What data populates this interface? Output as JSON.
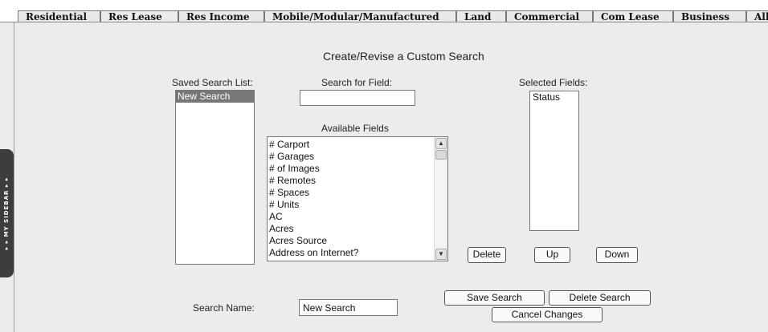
{
  "tabs": [
    {
      "label": "Residential",
      "active": false
    },
    {
      "label": "Res Lease",
      "active": true
    },
    {
      "label": "Res Income",
      "active": false
    },
    {
      "label": "Mobile/Modular/Manufactured",
      "active": false
    },
    {
      "label": "Land",
      "active": false
    },
    {
      "label": "Commercial",
      "active": false
    },
    {
      "label": "Com Lease",
      "active": false
    },
    {
      "label": "Business",
      "active": false
    },
    {
      "label": "All",
      "active": false
    }
  ],
  "sidebar": {
    "label": "▸ ▸   MY SIDEBAR   ▸ ▸"
  },
  "page": {
    "title": "Create/Revise a Custom Search"
  },
  "saved_search": {
    "label": "Saved Search List:",
    "items": [
      "New Search"
    ],
    "selected": "New Search"
  },
  "search_field": {
    "label": "Search for Field:",
    "value": ""
  },
  "available_fields": {
    "label": "Available Fields",
    "items": [
      "# Carport",
      "# Garages",
      "# of Images",
      "# Remotes",
      "# Spaces",
      "# Units",
      "AC",
      "Acres",
      "Acres Source",
      "Address on Internet?"
    ]
  },
  "selected_fields": {
    "label": "Selected Fields:",
    "items": [
      "Status"
    ]
  },
  "buttons": {
    "delete": "Delete",
    "up": "Up",
    "down": "Down",
    "save_search": "Save Search",
    "delete_search": "Delete Search",
    "cancel_changes": "Cancel Changes"
  },
  "search_name": {
    "label": "Search Name:",
    "value": "New Search"
  }
}
